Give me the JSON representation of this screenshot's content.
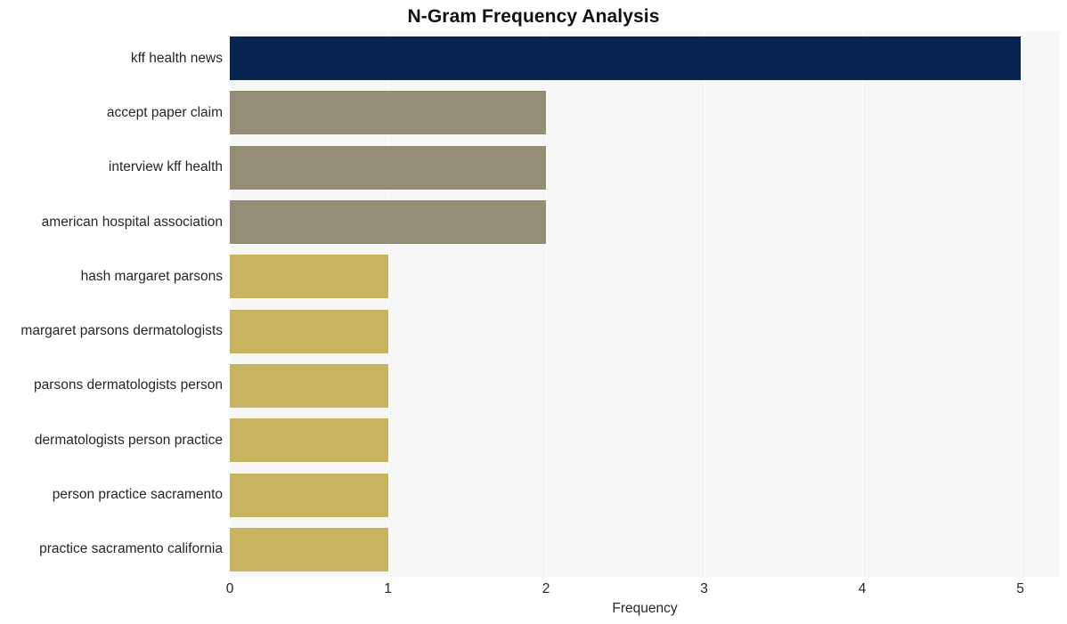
{
  "chart_data": {
    "type": "bar",
    "orientation": "horizontal",
    "title": "N-Gram Frequency Analysis",
    "xlabel": "Frequency",
    "ylabel": "",
    "categories": [
      "kff health news",
      "accept paper claim",
      "interview kff health",
      "american hospital association",
      "hash margaret parsons",
      "margaret parsons dermatologists",
      "parsons dermatologists person",
      "dermatologists person practice",
      "person practice sacramento",
      "practice sacramento california"
    ],
    "values": [
      5,
      2,
      2,
      2,
      1,
      1,
      1,
      1,
      1,
      1
    ],
    "bar_colors": [
      "#052452",
      "#928D74",
      "#928D74",
      "#928D74",
      "#C8B35E",
      "#C8B35E",
      "#C8B35E",
      "#C8B35E",
      "#C8B35E",
      "#C8B35E"
    ],
    "xlim": [
      0,
      5.25
    ],
    "xticks": [
      0,
      1,
      2,
      3,
      4,
      5
    ],
    "xtick_labels": [
      "0",
      "1",
      "2",
      "3",
      "4",
      "5"
    ],
    "grid": "vertical",
    "grid_color": "#ffffff",
    "plot_background": "#f7f7f7",
    "figure_background": "#ffffff",
    "legend": null,
    "title_color": "#121212",
    "tick_label_color": "#262626"
  }
}
